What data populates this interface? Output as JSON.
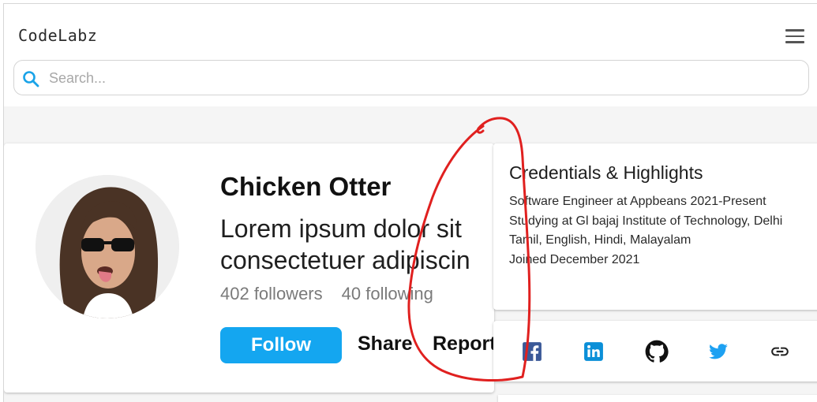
{
  "header": {
    "brand": "CodeLabz",
    "search_placeholder": "Search..."
  },
  "profile": {
    "name": "Chicken Otter",
    "bio": "Lorem ipsum dolor sit amet, consectetuer adipiscing elit",
    "bio_line1": "Lorem ipsum dolor sit",
    "bio_line2": "consectetuer adipiscin",
    "followers": "402 followers",
    "following": "40 following",
    "follow_label": "Follow",
    "share_label": "Share",
    "report_label": "Report"
  },
  "credentials": {
    "title": "Credentials & Highlights",
    "items": [
      "Software Engineer at Appbeans 2021-Present",
      "Studying at Gl bajaj Institute of Technology, Delhi",
      "Tamil, English, Hindi, Malayalam",
      "Joined December 2021"
    ]
  },
  "social": {
    "icons": [
      "facebook-icon",
      "linkedin-icon",
      "github-icon",
      "twitter-icon",
      "link-icon"
    ]
  },
  "colors": {
    "accent": "#14a6f0",
    "annotation": "#e0201f",
    "facebook": "#3b5998",
    "linkedin": "#0a8fd8",
    "twitter": "#1da1f2"
  }
}
